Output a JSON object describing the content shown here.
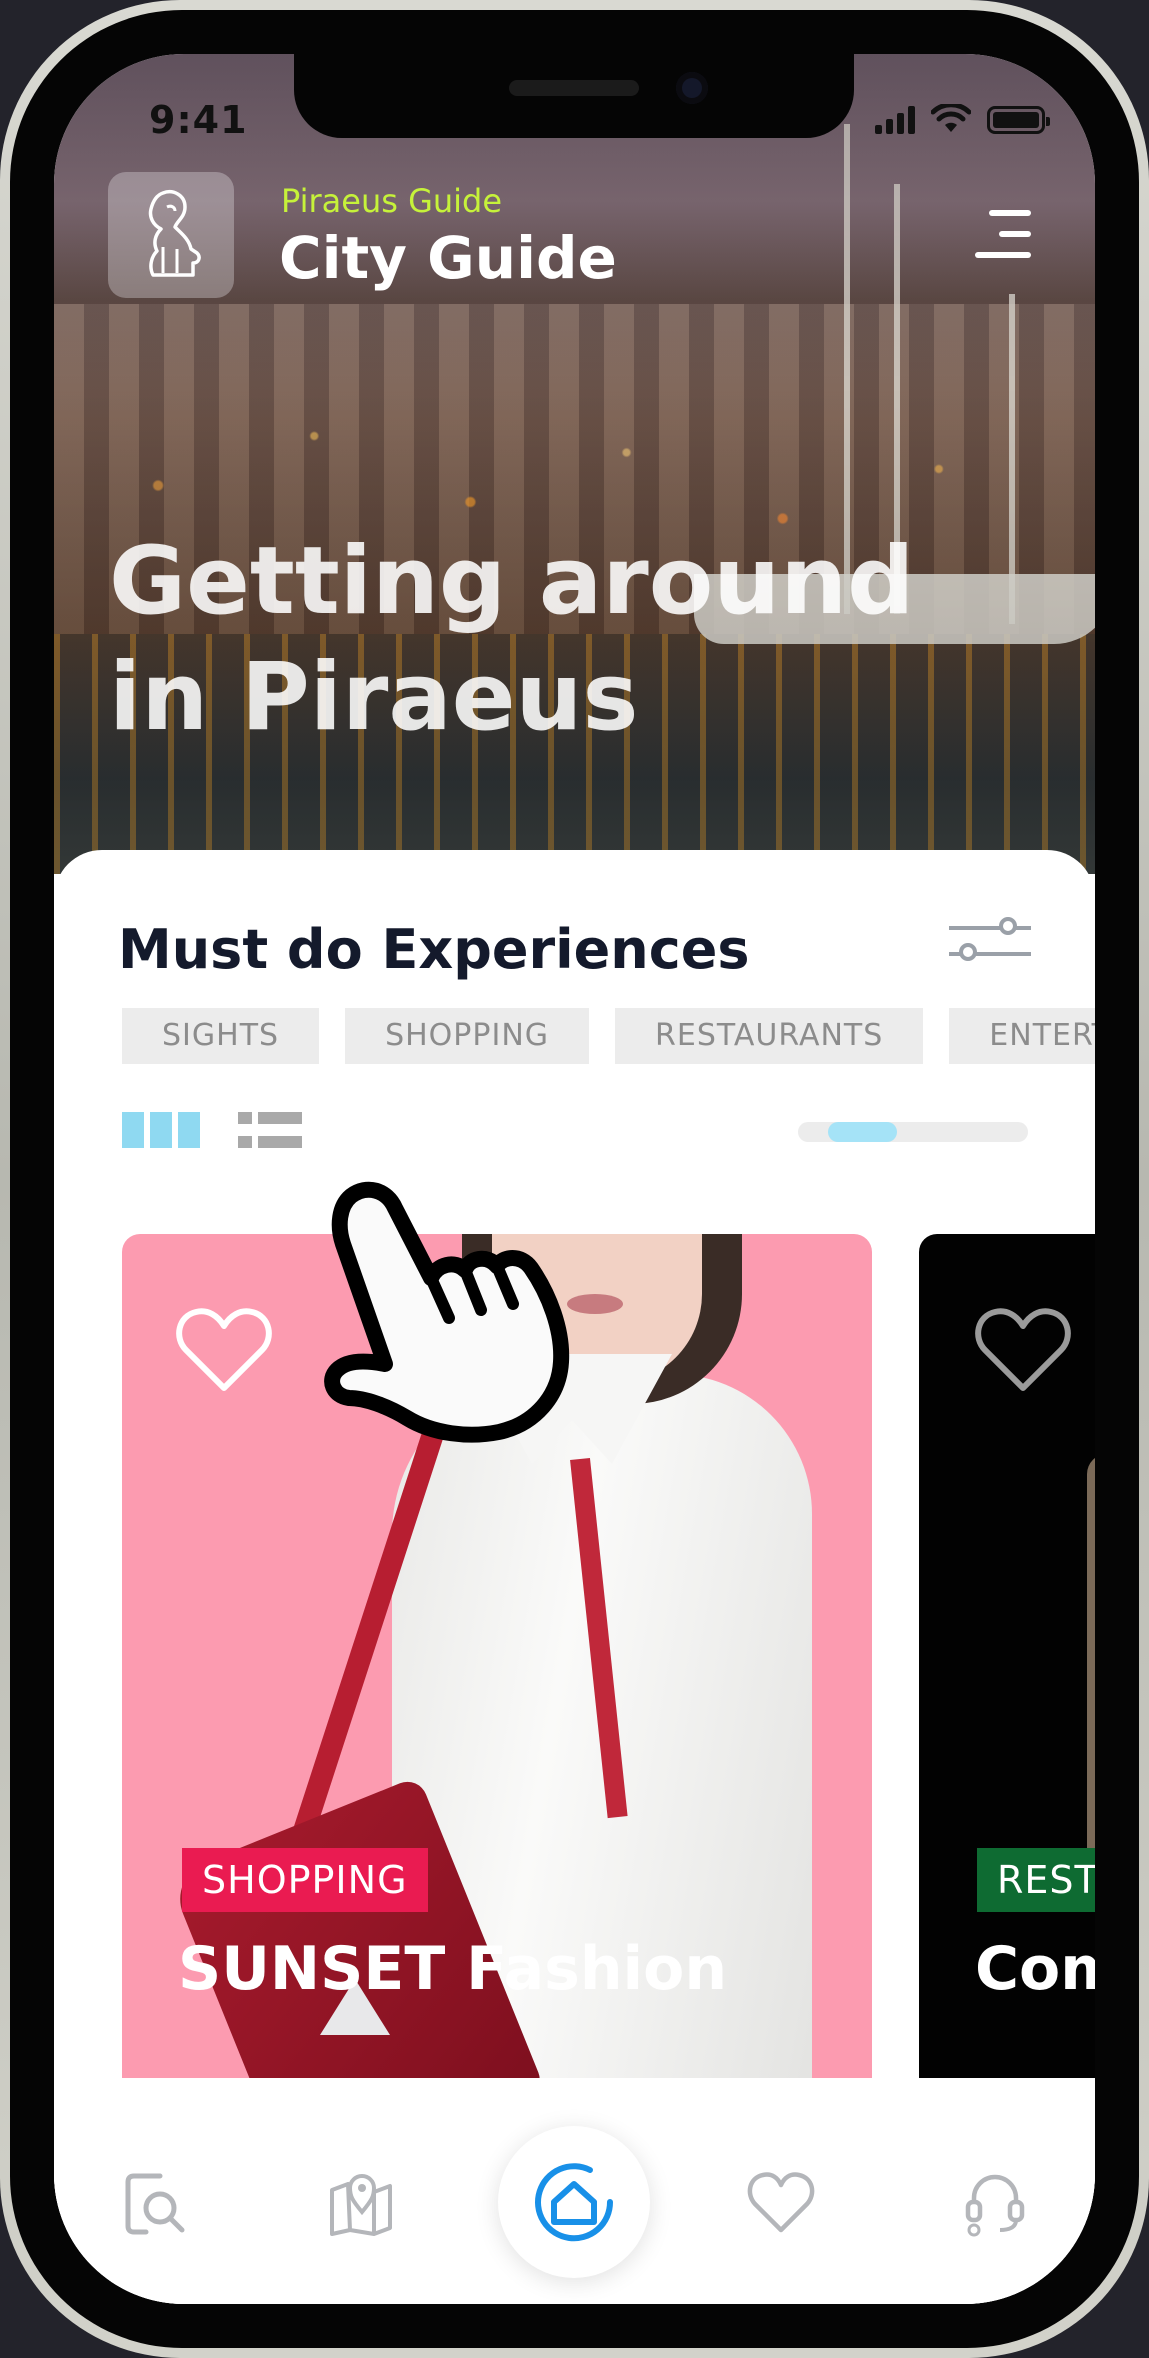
{
  "status_bar": {
    "time": "9:41"
  },
  "header": {
    "subtitle": "Piraeus Guide",
    "title": "City Guide"
  },
  "hero": {
    "title_line1": "Getting around",
    "title_line2": "in Piraeus"
  },
  "section": {
    "title": "Must do Experiences"
  },
  "tabs": [
    {
      "label": "SIGHTS"
    },
    {
      "label": "SHOPPING"
    },
    {
      "label": "RESTAURANTS"
    },
    {
      "label": "ENTERTA"
    }
  ],
  "carousel": {
    "scroll_progress_start": 0.13,
    "scroll_progress_end": 0.43
  },
  "cards": [
    {
      "badge": "SHOPPING",
      "badge_color": "#ea1b51",
      "title": "SUNSET Fashion",
      "background": "#fc9bb0",
      "favorited": false
    },
    {
      "badge": "RESTA",
      "badge_color": "#0e6b32",
      "title": "Com",
      "background": "#020202",
      "favorited": false
    }
  ],
  "colors": {
    "accent_lime": "#c6f23a",
    "accent_blue": "#1890e8",
    "view_active": "#8fd9f1"
  },
  "icons": {
    "logo": "lion-statue-icon",
    "menu": "hamburger-menu-icon",
    "filter": "sliders-icon",
    "grid": "grid-view-icon",
    "list": "list-view-icon",
    "favorite": "heart-outline-icon",
    "nav": [
      "search-document-icon",
      "map-pin-icon",
      "home-icon",
      "heart-icon",
      "support-headset-icon"
    ]
  }
}
